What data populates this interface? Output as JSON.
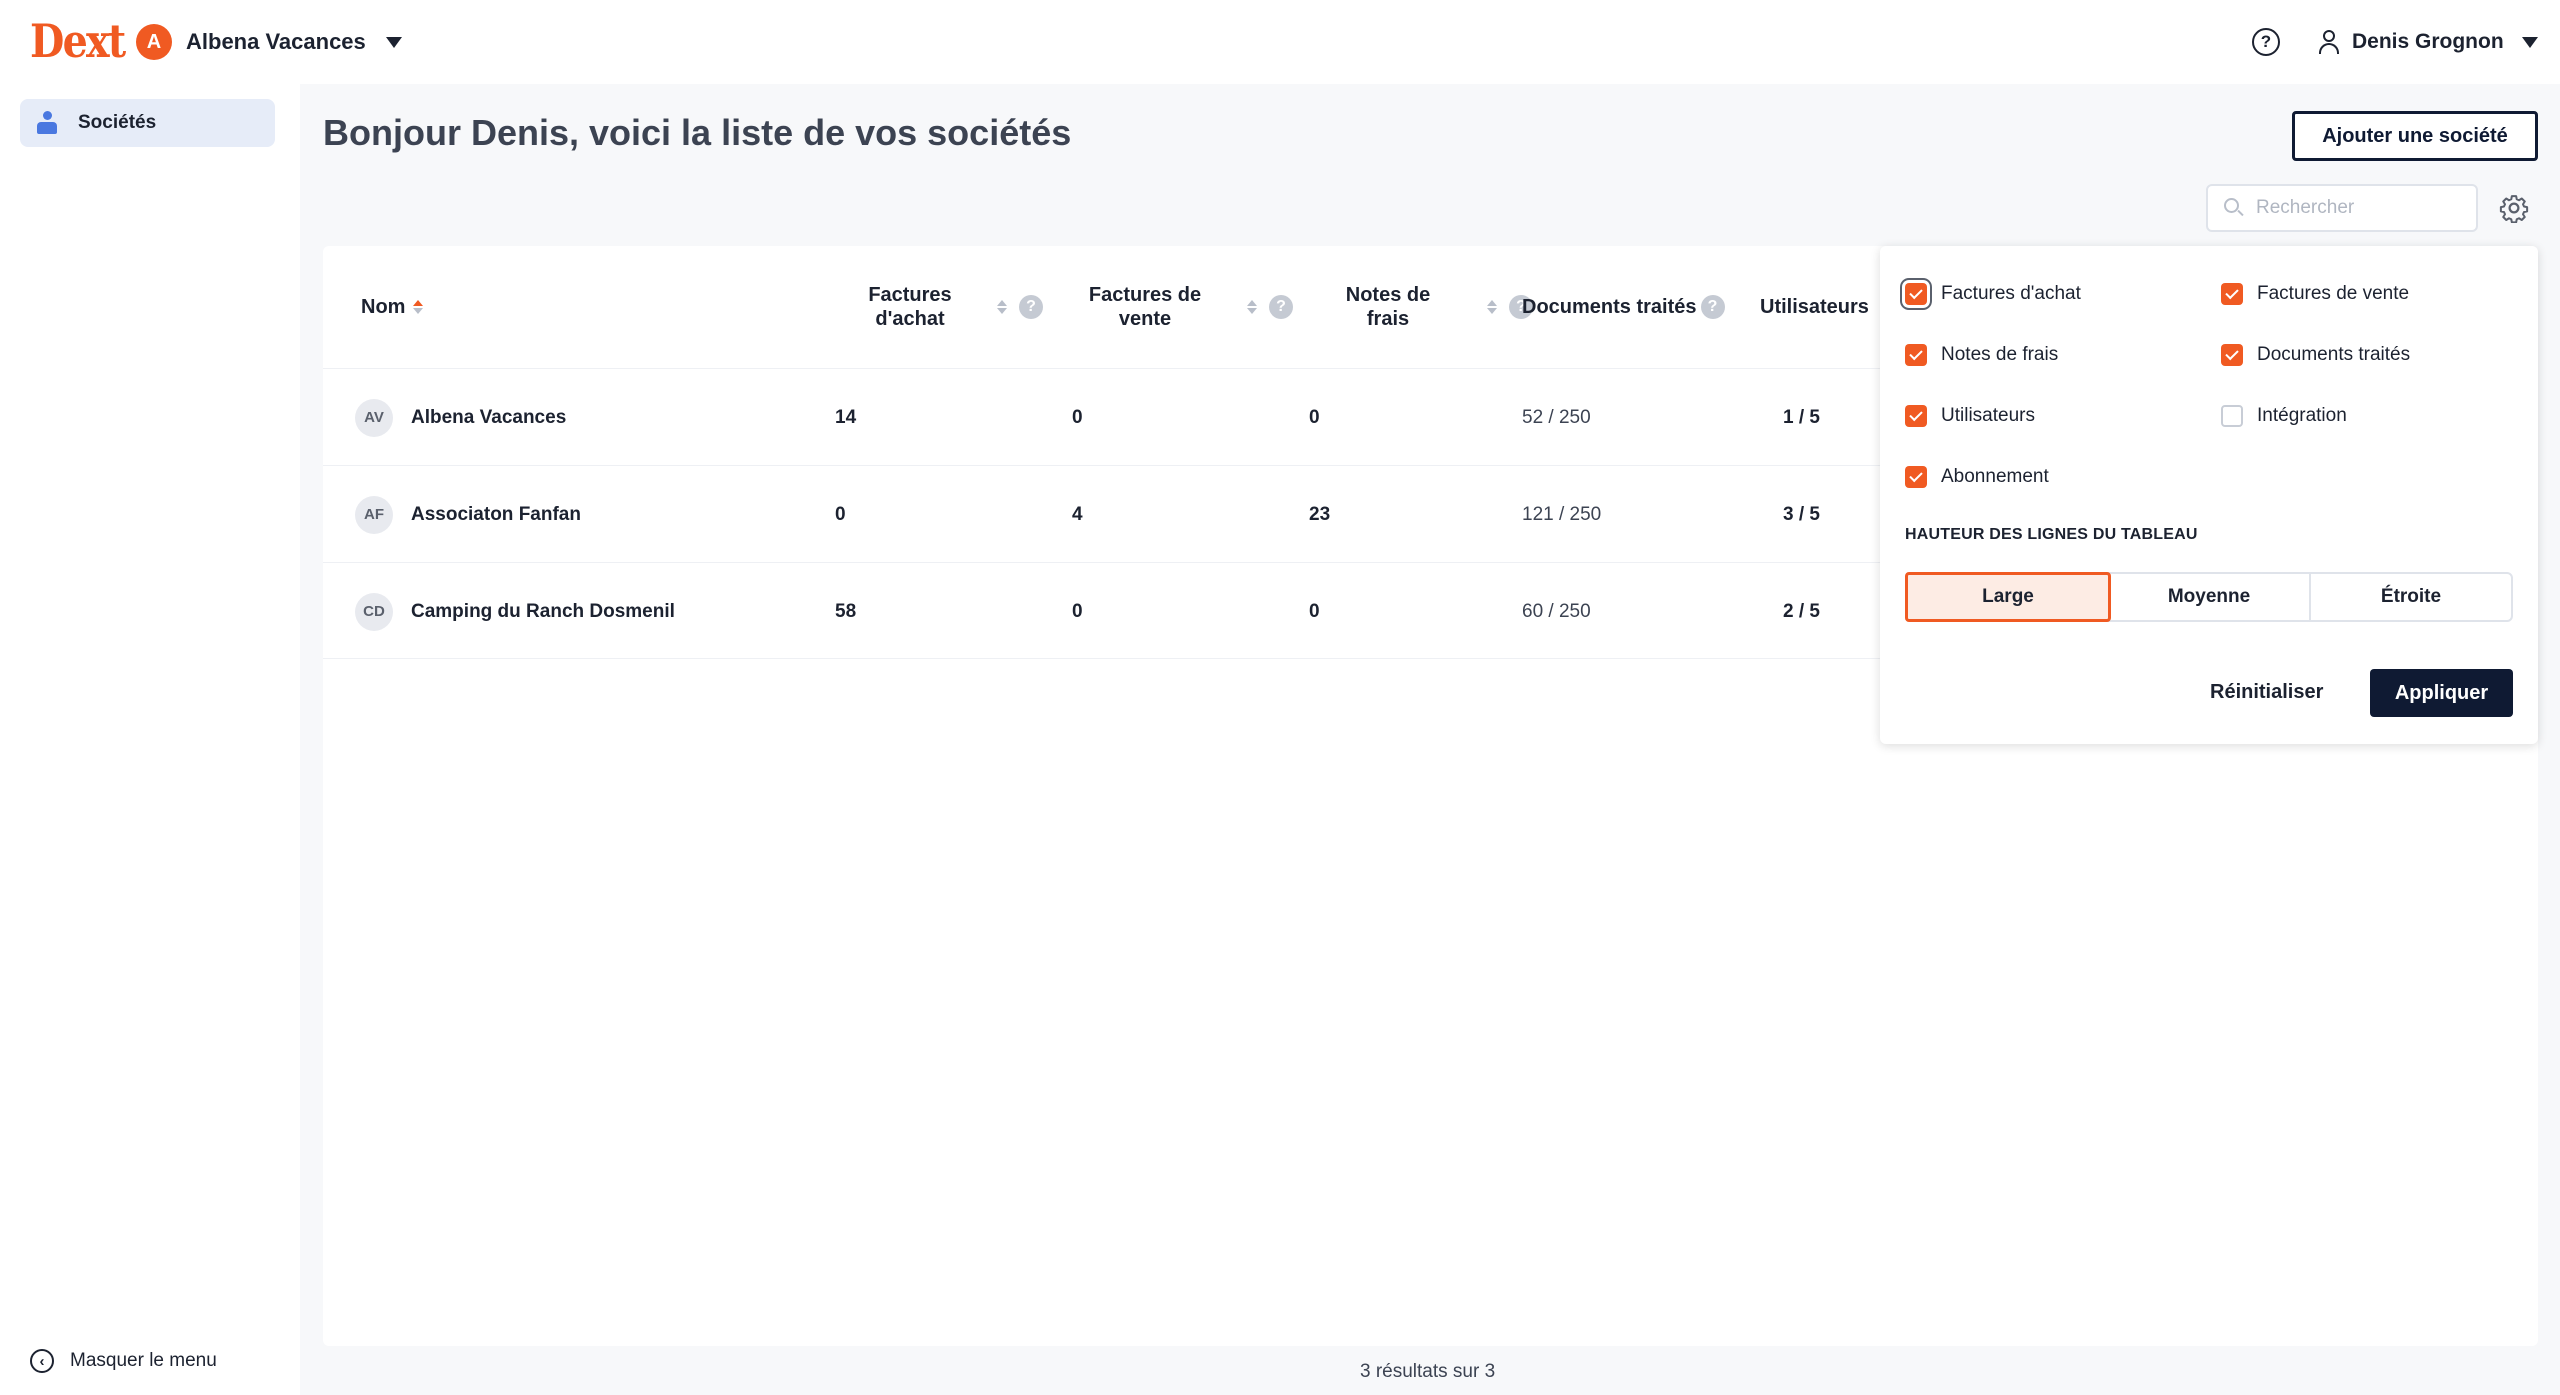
{
  "header": {
    "logo": "Dext",
    "company": {
      "initial": "A",
      "name": "Albena Vacances"
    },
    "help_symbol": "?",
    "user_name": "Denis Grognon"
  },
  "sidebar": {
    "items": [
      {
        "label": "Sociétés",
        "icon": "users-icon"
      }
    ],
    "hide_menu": "Masquer le menu"
  },
  "main": {
    "title": "Bonjour Denis, voici la liste de vos sociétés",
    "add_button": "Ajouter une société",
    "search_placeholder": "Rechercher"
  },
  "table": {
    "columns": {
      "name": "Nom",
      "purchase": [
        "Factures",
        "d'achat"
      ],
      "sales": [
        "Factures de",
        "vente"
      ],
      "expenses": [
        "Notes de",
        "frais"
      ],
      "documents": "Documents traités",
      "users": "Utilisateurs"
    },
    "rows": [
      {
        "initials": "AV",
        "name": "Albena Vacances",
        "purchase": "14",
        "sales": "0",
        "expenses": "0",
        "documents": "52 / 250",
        "users": "1 / 5"
      },
      {
        "initials": "AF",
        "name": "Associaton Fanfan",
        "purchase": "0",
        "sales": "4",
        "expenses": "23",
        "documents": "121 / 250",
        "users": "3 / 5"
      },
      {
        "initials": "CD",
        "name": "Camping du Ranch Dosmenil",
        "purchase": "58",
        "sales": "0",
        "expenses": "0",
        "documents": "60 / 250",
        "users": "2 / 5"
      }
    ],
    "results": "3 résultats sur 3"
  },
  "popover": {
    "options": [
      {
        "label": "Factures d'achat",
        "checked": true
      },
      {
        "label": "Factures de vente",
        "checked": true
      },
      {
        "label": "Notes de frais",
        "checked": true
      },
      {
        "label": "Documents traités",
        "checked": true
      },
      {
        "label": "Utilisateurs",
        "checked": true
      },
      {
        "label": "Intégration",
        "checked": false
      },
      {
        "label": "Abonnement",
        "checked": true
      }
    ],
    "row_height_title": "HAUTEUR DES LIGNES DU TABLEAU",
    "row_heights": [
      "Large",
      "Moyenne",
      "Étroite"
    ],
    "selected_row_height": "Large",
    "reset": "Réinitialiser",
    "apply": "Appliquer"
  },
  "colors": {
    "accent": "#f05a22",
    "navy": "#0f1a33",
    "sidebar_active": "#e6ecf8"
  }
}
